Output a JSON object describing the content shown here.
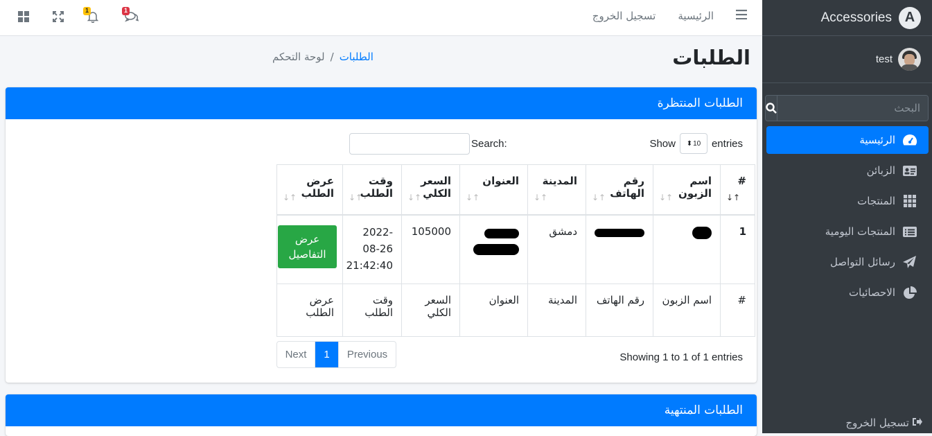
{
  "brand": {
    "name": "Accessories",
    "logo_letter": "A"
  },
  "user": {
    "name": "test"
  },
  "sidebar": {
    "search_placeholder": "البحث",
    "items": [
      {
        "label": "الرئيسية",
        "icon": "dashboard-icon",
        "active": true
      },
      {
        "label": "الزبائن",
        "icon": "id-card-icon",
        "active": false
      },
      {
        "label": "المنتجات",
        "icon": "grid-icon",
        "active": false
      },
      {
        "label": "المنتجات اليومية",
        "icon": "list-alt-icon",
        "active": false
      },
      {
        "label": "رسائل التواصل",
        "icon": "paper-plane-icon",
        "active": false
      },
      {
        "label": "الاحصائيات",
        "icon": "pie-chart-icon",
        "active": false
      }
    ],
    "logout": "تسجيل الخروج"
  },
  "topbar": {
    "home": "الرئيسية",
    "logout": "تسجيل الخروج",
    "messages_badge": "1",
    "notifications_badge": "1"
  },
  "header": {
    "title": "الطلبات",
    "breadcrumb_active": "الطلبات",
    "breadcrumb_home": "لوحة التحكم"
  },
  "pending_card": {
    "title": "الطلبات المنتظرة",
    "show_label": "Show",
    "entries_label": "entries",
    "page_length": "10",
    "search_label": "Search:",
    "columns": [
      "#",
      "اسم الزبون",
      "رقم الهاتف",
      "المدينة",
      "العنوان",
      "السعر الكلي",
      "وقت الطلب",
      "عرض الطلب"
    ],
    "rows": [
      {
        "num": "1",
        "city": "دمشق",
        "total": "105000",
        "time": "2022-08-26 21:42:40",
        "action": "عرض التفاصيل"
      }
    ],
    "footer_columns": [
      "#",
      "اسم الزبون",
      "رقم الهاتف",
      "المدينة",
      "العنوان",
      "السعر الكلي",
      "وقت الطلب",
      "عرض الطلب"
    ],
    "info": "Showing 1 to 1 of 1 entries",
    "pagination": {
      "prev": "Previous",
      "current": "1",
      "next": "Next"
    }
  },
  "finished_card": {
    "title": "الطلبات المنتهية"
  },
  "colors": {
    "primary": "#007bff",
    "success": "#28a745",
    "sidebar_bg": "#343a40",
    "danger": "#dc3545",
    "warning": "#ffc107"
  }
}
